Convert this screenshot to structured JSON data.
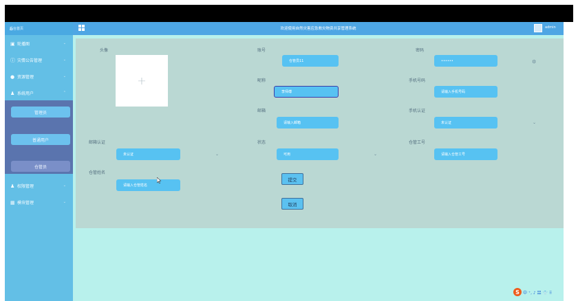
{
  "header": {
    "title": "欢迎使用自然灾害应急救灾物资共享管理系统",
    "username": "admin"
  },
  "sidebar": {
    "home": "后台首页",
    "items": [
      {
        "label": "轮播图",
        "icon": "image-icon"
      },
      {
        "label": "灾情公告管理",
        "icon": "info-icon"
      },
      {
        "label": "资源管理",
        "icon": "location-icon"
      },
      {
        "label": "系统用户",
        "icon": "user-icon"
      },
      {
        "label": "权限管理",
        "icon": "user-icon"
      },
      {
        "label": "模块管理",
        "icon": "grid-icon"
      }
    ],
    "sub_items": [
      "管理员",
      "普通用户",
      "仓管员"
    ]
  },
  "form": {
    "avatar_label": "头像",
    "avatar_plus": "+",
    "account_label": "账号",
    "account_value": "仓管员11",
    "password_label": "密码",
    "password_value": "••••••",
    "nickname_label": "昵称",
    "nickname_value": "李师傅",
    "phone_label": "手机号码",
    "phone_placeholder": "请输入手机号码",
    "email_label": "邮箱",
    "email_placeholder": "请输入邮箱",
    "phone_verify_label": "手机认证",
    "phone_verify_value": "未认证",
    "email_verify_label": "邮箱认证",
    "email_verify_value": "未认证",
    "status_label": "状态",
    "status_value": "可用",
    "job_no_label": "仓管工号",
    "job_no_placeholder": "请输入仓管工号",
    "keeper_name_label": "仓管姓名",
    "keeper_name_placeholder": "请输入仓管姓名"
  },
  "buttons": {
    "submit": "提交",
    "cancel": "取消"
  },
  "tray": {
    "text": "中 ⁺, ♪ 㗊 👕 ⠿"
  }
}
